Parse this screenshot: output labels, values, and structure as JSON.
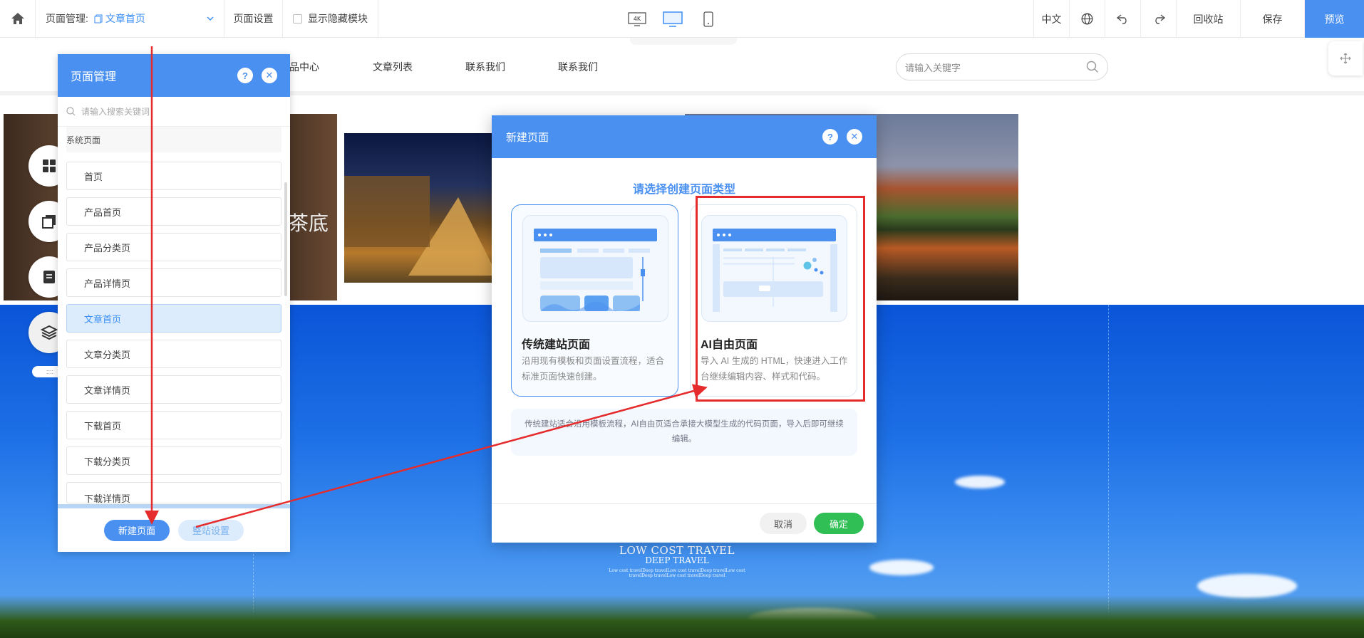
{
  "toolbar": {
    "page_mgmt_label": "页面管理:",
    "current_page": "文章首页",
    "page_settings": "页面设置",
    "show_hidden": "显示隐藏模块",
    "device_4k": "4K",
    "lang": "中文",
    "recycle": "回收站",
    "save": "保存",
    "preview": "预览",
    "icons": [
      "home-icon",
      "page-doc-icon",
      "chevron-down-icon",
      "desktop-icon",
      "mobile-icon",
      "globe-icon",
      "undo-icon",
      "redo-icon"
    ]
  },
  "site": {
    "nav": [
      "品中心",
      "文章列表",
      "联系我们",
      "联系我们"
    ],
    "search_placeholder": "请输入关键字",
    "photo_text": "茶底",
    "travel": {
      "line1": "LOW COST TRAVEL",
      "line2": "DEEP TRAVEL",
      "line3": "Low cost travelDeep travelLow cost travelDeep travelLow cost travelDeep travelLow cost travelDeep travel"
    },
    "handle": "::::"
  },
  "page_panel": {
    "title": "页面管理",
    "search_placeholder": "请输入搜索关键词",
    "section": "系统页面",
    "items": [
      "首页",
      "产品首页",
      "产品分类页",
      "产品详情页",
      "文章首页",
      "文章分类页",
      "文章详情页",
      "下载首页",
      "下载分类页",
      "下载详情页"
    ],
    "active_index": 4,
    "new_page": "新建页面",
    "site_settings": "整站设置"
  },
  "modal": {
    "title": "新建页面",
    "prompt": "请选择创建页面类型",
    "cards": [
      {
        "title": "传统建站页面",
        "desc": "沿用现有模板和页面设置流程，适合标准页面快速创建。"
      },
      {
        "title": "AI自由页面",
        "desc": "导入 AI 生成的 HTML，快速进入工作台继续编辑内容、样式和代码。"
      }
    ],
    "note": "传统建站适合沿用模板流程，AI自由页适合承接大模型生成的代码页面，导入后即可继续编辑。",
    "cancel": "取消",
    "confirm": "确定"
  },
  "colors": {
    "accent": "#4a90f0",
    "confirm": "#2fbf54",
    "annotation": "#e52b2b"
  }
}
